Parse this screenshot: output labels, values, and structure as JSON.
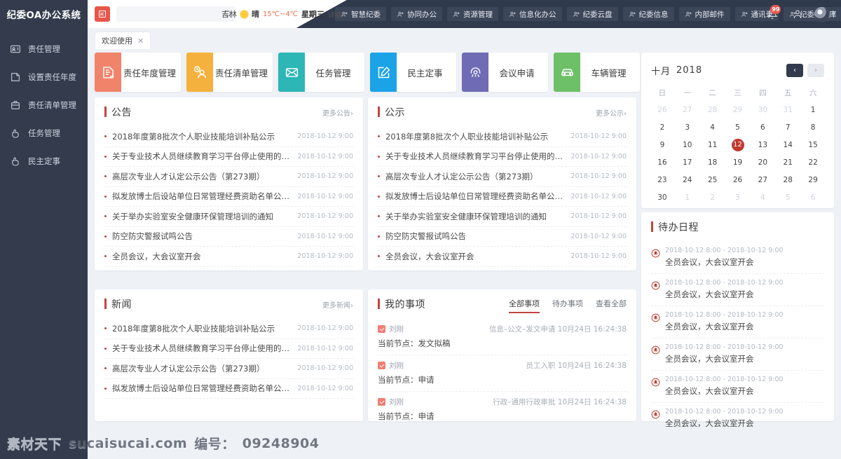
{
  "app": {
    "brand": "纪委OA办公系统"
  },
  "header": {
    "menu_toggle_icon": "menu-collapse-icon",
    "search": {
      "value": "",
      "placeholder": ""
    },
    "weather": {
      "city": "吉林",
      "condition": "晴",
      "temperature": "15℃~4℃",
      "weekday": "星期三",
      "detail": "详细›"
    },
    "nav_items": [
      {
        "label": "智慧纪委",
        "icon": "people-icon"
      },
      {
        "label": "协同办公",
        "icon": "people-icon"
      },
      {
        "label": "资源管理",
        "icon": "people-icon"
      },
      {
        "label": "信息化办公",
        "icon": "people-icon"
      },
      {
        "label": "纪委云盘",
        "icon": "people-icon"
      },
      {
        "label": "纪委信息",
        "icon": "people-icon"
      },
      {
        "label": "内部邮件",
        "icon": "people-icon"
      },
      {
        "label": "通讯录",
        "icon": "people-icon"
      },
      {
        "label": "纪委知识库",
        "icon": "people-icon"
      }
    ],
    "nav_more": "···",
    "notification_badge": "99",
    "accent_red": "#e8564a",
    "navbar_bg": "#303a4d"
  },
  "sidebar": {
    "items": [
      {
        "label": "责任管理",
        "icon": "id-card-icon"
      },
      {
        "label": "设置责任年度",
        "icon": "document-icon"
      },
      {
        "label": "责任清单管理",
        "icon": "briefcase-icon"
      },
      {
        "label": "任务管理",
        "icon": "hand-point-icon"
      },
      {
        "label": "民主定事",
        "icon": "hand-point-icon"
      }
    ]
  },
  "tabs": {
    "open": [
      {
        "label": "欢迎使用",
        "close_icon": "close-icon"
      }
    ]
  },
  "shortcuts": [
    {
      "label": "责任年度管理",
      "color": "#f2836b",
      "icon": "document-arrow-icon"
    },
    {
      "label": "责任清单管理",
      "color": "#f5b13d",
      "icon": "user-clock-icon"
    },
    {
      "label": "任务管理",
      "color": "#2cb6b6",
      "icon": "mail-icon"
    },
    {
      "label": "民主定事",
      "color": "#1ba3e8",
      "icon": "edit-square-icon"
    },
    {
      "label": "会议申请",
      "color": "#6f6bb5",
      "icon": "meeting-icon"
    },
    {
      "label": "车辆管理",
      "color": "#6dc067",
      "icon": "car-icon"
    }
  ],
  "announcements": {
    "title": "公告",
    "more": "更多公告›",
    "rows": [
      {
        "title": "2018年度第8批次个人职业技能培训补贴公示",
        "date": "2018-10-12 9:00"
      },
      {
        "title": "关于专业技术人员继续教育学习平台停止使用的温馨提示",
        "date": "2018-10-12 9:00"
      },
      {
        "title": "高层次专业人才认定公示公告（第273期）",
        "date": "2018-10-12 9:00"
      },
      {
        "title": "拟发放博士后设站单位日常管理经费资助名单公示...",
        "date": "2018-10-12 9:00"
      },
      {
        "title": "关于举办实验室安全健康环保管理培训的通知",
        "date": "2018-10-12 9:00"
      },
      {
        "title": "防空防灾警报试鸣公告",
        "date": "2018-10-12 9:00"
      },
      {
        "title": "全员会议，大会议室开会",
        "date": "2018-10-12 9:00"
      }
    ]
  },
  "publicity": {
    "title": "公示",
    "more": "更多公示›",
    "rows": [
      {
        "title": "2018年度第8批次个人职业技能培训补贴公示",
        "date": "2018-10-12 9:00"
      },
      {
        "title": "关于专业技术人员继续教育学习平台停止使用的温馨提示",
        "date": "2018-10-12 9:00"
      },
      {
        "title": "高层次专业人才认定公示公告（第273期）",
        "date": "2018-10-12 9:00"
      },
      {
        "title": "拟发放博士后设站单位日常管理经费资助名单公示...",
        "date": "2018-10-12 9:00"
      },
      {
        "title": "关于举办实验室安全健康环保管理培训的通知",
        "date": "2018-10-12 9:00"
      },
      {
        "title": "防空防灾警报试鸣公告",
        "date": "2018-10-12 9:00"
      },
      {
        "title": "全员会议，大会议室开会",
        "date": "2018-10-12 9:00"
      }
    ]
  },
  "news": {
    "title": "新闻",
    "more": "更多新闻›",
    "rows": [
      {
        "title": "2018年度第8批次个人职业技能培训补贴公示",
        "date": "2018-10-12 9:00"
      },
      {
        "title": "关于专业技术人员继续教育学习平台停止使用的温馨提示",
        "date": "2018-10-12 9:00"
      },
      {
        "title": "高层次专业人才认定公示公告（第273期）",
        "date": "2018-10-12 9:00"
      },
      {
        "title": "拟发放博士后设站单位日常管理经费资助名单公示...",
        "date": "2018-10-12 9:00"
      }
    ]
  },
  "my_items": {
    "title": "我的事项",
    "tabs": [
      {
        "label": "全部事项",
        "active": true
      },
      {
        "label": "待办事项",
        "active": false
      },
      {
        "label": "查看全部",
        "active": false
      }
    ],
    "rows": [
      {
        "user": "刘刚",
        "meta": "信息–公文–发文申请 10月24日 16:24:38",
        "node": "当前节点：发文拟稿"
      },
      {
        "user": "刘刚",
        "meta": "员工入职 10月24日 16:24:38",
        "node": "当前节点：申请"
      },
      {
        "user": "刘刚",
        "meta": "行政–通用行政审批 10月24日 16:24:38",
        "node": "当前节点：申请"
      }
    ]
  },
  "calendar": {
    "month": "十月",
    "year": "2018",
    "prev_icon": "chevron-left-icon",
    "next_icon": "chevron-right-icon",
    "weekdays": [
      "日",
      "一",
      "二",
      "三",
      "四",
      "五",
      "六"
    ],
    "selected_day": 12,
    "weeks": [
      [
        {
          "d": "26",
          "mute": true
        },
        {
          "d": "27",
          "mute": true
        },
        {
          "d": "28",
          "mute": true
        },
        {
          "d": "29",
          "mute": true
        },
        {
          "d": "30",
          "mute": true
        },
        {
          "d": "31",
          "mute": true
        },
        {
          "d": "1",
          "mute": false
        }
      ],
      [
        {
          "d": "2",
          "mute": false
        },
        {
          "d": "3",
          "mute": false
        },
        {
          "d": "4",
          "mute": false
        },
        {
          "d": "5",
          "mute": false
        },
        {
          "d": "6",
          "mute": false
        },
        {
          "d": "7",
          "mute": false
        },
        {
          "d": "8",
          "mute": false
        }
      ],
      [
        {
          "d": "9",
          "mute": false
        },
        {
          "d": "10",
          "mute": false
        },
        {
          "d": "11",
          "mute": false
        },
        {
          "d": "12",
          "mute": false,
          "sel": true
        },
        {
          "d": "13",
          "mute": false
        },
        {
          "d": "14",
          "mute": false
        },
        {
          "d": "15",
          "mute": false
        }
      ],
      [
        {
          "d": "16",
          "mute": false
        },
        {
          "d": "17",
          "mute": false
        },
        {
          "d": "18",
          "mute": false
        },
        {
          "d": "19",
          "mute": false
        },
        {
          "d": "20",
          "mute": false
        },
        {
          "d": "21",
          "mute": false
        },
        {
          "d": "22",
          "mute": false
        }
      ],
      [
        {
          "d": "23",
          "mute": false
        },
        {
          "d": "24",
          "mute": false
        },
        {
          "d": "25",
          "mute": false
        },
        {
          "d": "26",
          "mute": false
        },
        {
          "d": "27",
          "mute": false
        },
        {
          "d": "28",
          "mute": false
        },
        {
          "d": "29",
          "mute": false
        }
      ],
      [
        {
          "d": "30",
          "mute": false
        },
        {
          "d": "1",
          "mute": true
        },
        {
          "d": "2",
          "mute": true
        },
        {
          "d": "3",
          "mute": true
        },
        {
          "d": "4",
          "mute": true
        },
        {
          "d": "5",
          "mute": true
        },
        {
          "d": "6",
          "mute": true
        }
      ]
    ]
  },
  "schedule": {
    "title": "待办日程",
    "rows": [
      {
        "time": "2018-10-12 8:00 - 2018-10-12 9:00",
        "text": "全员会议，大会议室开会"
      },
      {
        "time": "2018-10-12 8:00 - 2018-10-12 9:00",
        "text": "全员会议，大会议室开会"
      },
      {
        "time": "2018-10-12 8:00 - 2018-10-12 9:00",
        "text": "全员会议，大会议室开会"
      },
      {
        "time": "2018-10-12 8:00 - 2018-10-12 9:00",
        "text": "全员会议，大会议室开会"
      },
      {
        "time": "2018-10-12 8:00 - 2018-10-12 9:00",
        "text": "全员会议，大会议室开会"
      },
      {
        "time": "2018-10-12 8:00 - 2018-10-12 9:00",
        "text": "全员会议，大会议室开会"
      }
    ]
  },
  "watermark": {
    "site_cn": "素材天下",
    "site_url": "sucaisucai.com",
    "id_label": "编号：",
    "id_value": "09248904"
  }
}
